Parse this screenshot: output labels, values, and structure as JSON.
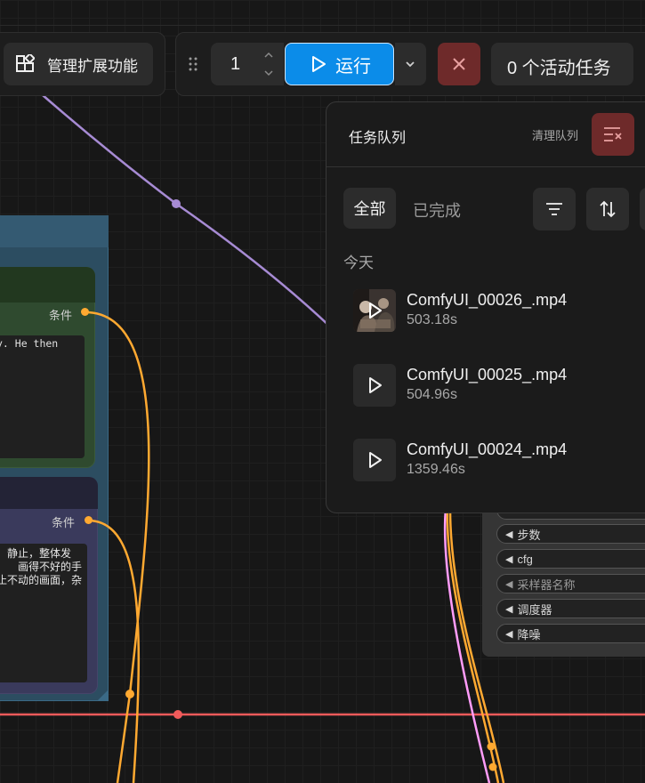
{
  "toolbar": {
    "extensions_label": "管理扩展功能",
    "batch_count": "1",
    "run_label": "运行",
    "active_tasks_label": "0 个活动任务"
  },
  "nodes": {
    "positive": {
      "output_label": "条件",
      "text_line": "y. He then"
    },
    "negative": {
      "output_label": "条件",
      "text_lines": [
        "，静止，整体发",
        "画得不好的手",
        "止不动的画面，杂"
      ]
    },
    "sampler_widgets": [
      "步数",
      "cfg",
      "采样器名称",
      "调度器",
      "降噪"
    ]
  },
  "queue": {
    "title": "任务队列",
    "clear_label": "清理队列",
    "tabs": {
      "all": "全部",
      "completed": "已完成"
    },
    "section_today": "今天",
    "items": [
      {
        "name": "ComfyUI_00026_.mp4",
        "time": "503.18s",
        "thumbnail": "video-frame"
      },
      {
        "name": "ComfyUI_00025_.mp4",
        "time": "504.96s",
        "thumbnail": "play-icon"
      },
      {
        "name": "ComfyUI_00024_.mp4",
        "time": "1359.46s",
        "thumbnail": "play-icon"
      }
    ]
  },
  "colors": {
    "run_button": "#0b8ce9",
    "cancel_button": "#6e2a2a",
    "wire_clip": "#a78bd4",
    "wire_conditioning": "#ffa931",
    "wire_latent": "#ff9cf9",
    "wire_red": "#f05a5a",
    "node_positive": "#2f4a2f",
    "node_negative": "#3a3a5c",
    "group": "#2c4d61"
  }
}
